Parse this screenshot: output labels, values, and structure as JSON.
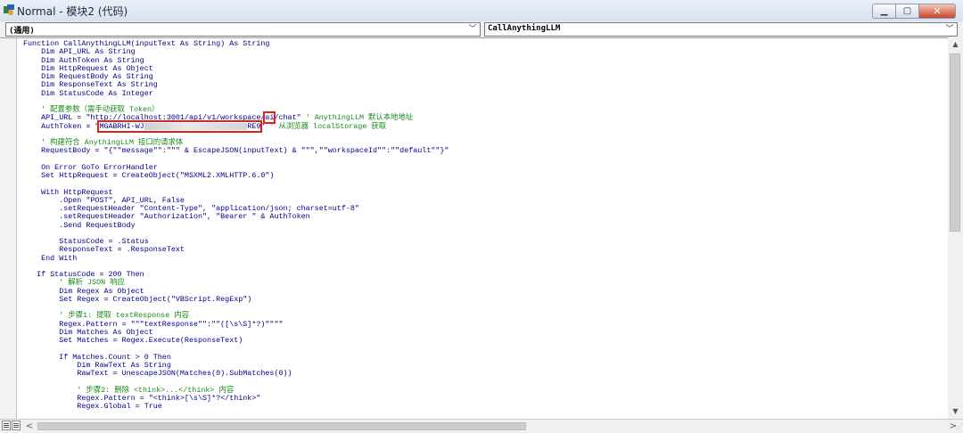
{
  "window": {
    "title": "Normal - 模块2 (代码)",
    "buttons": {
      "minimize": "minimize",
      "maximize": "maximize",
      "close": "close"
    }
  },
  "combos": {
    "object": "(通用)",
    "procedure": "CallAnythingLLM"
  },
  "code": {
    "lines": [
      "Function CallAnythingLLM(inputText As String) As String",
      "    Dim API_URL As String",
      "    Dim AuthToken As String",
      "    Dim HttpRequest As Object",
      "    Dim RequestBody As String",
      "    Dim ResponseText As String",
      "    Dim StatusCode As Integer",
      "",
      "    ' 配置参数（需手动获取 Token）",
      "    API_URL = \"http://localhost:3001/api/v1/workspace/ai/chat\" ' AnythingLLM 默认本地地址",
      "    AuthToken = \"MGABRHI-WJ                       RE9\" ' 从浏览器 localStorage 获取",
      "",
      "    ' 构建符合 AnythingLLM 接口的请求体",
      "    RequestBody = \"{\"\"message\"\":\"\"\" & EscapeJSON(inputText) & \"\"\",\"\"workspaceId\"\":\"\"default\"\"}\"",
      "",
      "    On Error GoTo ErrorHandler",
      "    Set HttpRequest = CreateObject(\"MSXML2.XMLHTTP.6.0\")",
      "",
      "    With HttpRequest",
      "        .Open \"POST\", API_URL, False",
      "        .setRequestHeader \"Content-Type\", \"application/json; charset=utf-8\"",
      "        .setRequestHeader \"Authorization\", \"Bearer \" & AuthToken",
      "        .Send RequestBody",
      "",
      "        StatusCode = .Status",
      "        ResponseText = .ResponseText",
      "    End With",
      "",
      "   If StatusCode = 200 Then",
      "        ' 解析 JSON 响应",
      "        Dim Regex As Object",
      "        Set Regex = CreateObject(\"VBScript.RegExp\")",
      "",
      "        ' 步骤1: 提取 textResponse 内容",
      "        Regex.Pattern = \"\"\"textResponse\"\":\"\"([\\s\\S]*?)\"\"\"\"",
      "        Dim Matches As Object",
      "        Set Matches = Regex.Execute(ResponseText)",
      "",
      "        If Matches.Count > 0 Then",
      "            Dim RawText As String",
      "            RawText = UnescapeJSON(Matches(0).SubMatches(0))",
      "",
      "            ' 步骤2: 删除 <think>...</think> 内容",
      "            Regex.Pattern = \"<think>[\\s\\S]*?</think>\"",
      "            Regex.Global = True"
    ]
  }
}
